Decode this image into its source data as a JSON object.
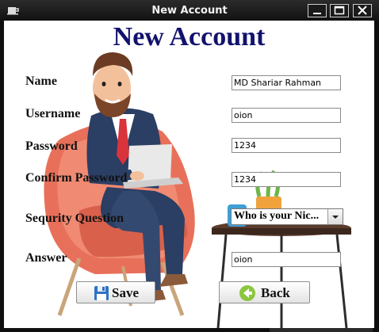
{
  "window": {
    "title": "New Account",
    "controls": [
      "minimize-icon",
      "maximize-icon",
      "close-icon"
    ]
  },
  "form": {
    "heading": "New Account",
    "name_label": "Name",
    "name_value": "MD Shariar Rahman",
    "username_label": "Username",
    "username_value": "oion",
    "password_label": "Password",
    "password_value": "1234",
    "confirm_label": "Confirm Password",
    "confirm_value": "1234",
    "question_label": "Sequrity Question",
    "question_selected": "Who is your Nic...",
    "answer_label": "Answer",
    "answer_value": "oion"
  },
  "buttons": {
    "save_label": "Save",
    "save_icon": "floppy-disk-icon",
    "back_label": "Back",
    "back_icon": "back-arrow-icon"
  },
  "colors": {
    "heading": "#12126e",
    "titlebar": "#1a1a1a",
    "chair": "#e8705a",
    "suit": "#2b3e63"
  }
}
